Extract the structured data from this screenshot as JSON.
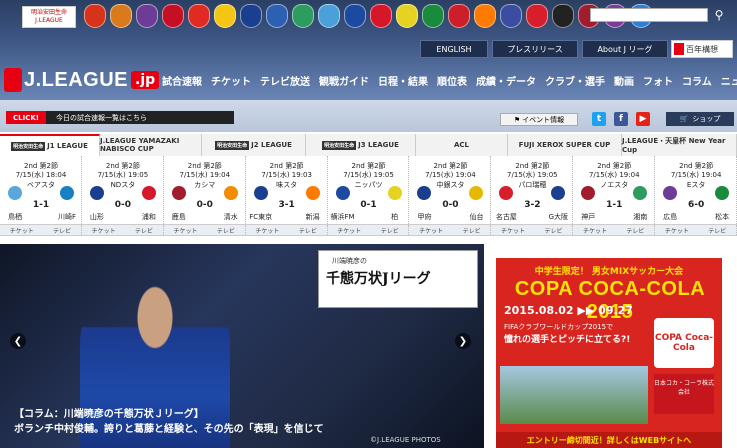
{
  "header": {
    "sponsor_top": "明治安田生命",
    "sponsor_bottom": "J.LEAGUE",
    "crest_colors": [
      "#d5341b",
      "#d97a1c",
      "#6d3c96",
      "#c60f25",
      "#e02a22",
      "#f2c613",
      "#1b3f8f",
      "#2d5fb3",
      "#2d9c5f",
      "#4aa0d8",
      "#1b4aa0",
      "#d6172a",
      "#e6d321",
      "#1a8a3c",
      "#cc1f2a",
      "#ff7a00",
      "#3b4da0",
      "#d81e2b",
      "#222",
      "#a11c2c",
      "#7b3c98",
      "#2e7fd0"
    ],
    "search_placeholder": "",
    "buttons": {
      "english": "ENGLISH",
      "press": "プレスリリース",
      "about": "About J リーグ"
    },
    "vision_label": "百年構想"
  },
  "logo": {
    "text": "J.LEAGUE",
    "suffix": ".jp"
  },
  "nav": [
    "試合速報",
    "チケット",
    "テレビ放送",
    "観戦ガイド",
    "日程・結果",
    "順位表",
    "成績・データ",
    "クラブ・選手",
    "動画",
    "フォト",
    "コラム",
    "ニュース"
  ],
  "subbar": {
    "click_label": "CLICK!",
    "today_label": "今日の試合速報一覧はこちら",
    "event_label": "イベント情報",
    "shop_label": "ショップ"
  },
  "tabs": [
    {
      "badge": "明治安田生命",
      "label": "J1 LEAGUE",
      "active": true
    },
    {
      "badge": "",
      "label": "J.LEAGUE YAMAZAKI NABISCO CUP",
      "active": false
    },
    {
      "badge": "明治安田生命",
      "label": "J2 LEAGUE",
      "active": false
    },
    {
      "badge": "明治安田生命",
      "label": "J3 LEAGUE",
      "active": false
    },
    {
      "badge": "",
      "label": "ACL",
      "active": false
    },
    {
      "badge": "",
      "label": "FUJI XEROX SUPER CUP",
      "active": false
    },
    {
      "badge": "",
      "label": "J.LEAGUE・天皇杯 New Year Cup",
      "active": false
    }
  ],
  "matches": [
    {
      "round": "2nd 第2節",
      "date": "7/15(水) 18:04",
      "venue": "ベアスタ",
      "home": "鳥栖",
      "score": "1-1",
      "away": "川崎F",
      "hc": "#5aa7dc",
      "ac": "#1b7fc3"
    },
    {
      "round": "2nd 第2節",
      "date": "7/15(水) 19:05",
      "venue": "NDスタ",
      "home": "山形",
      "score": "0-0",
      "away": "浦和",
      "hc": "#1b3f8f",
      "ac": "#d6172a"
    },
    {
      "round": "2nd 第2節",
      "date": "7/15(水) 19:04",
      "venue": "カシマ",
      "home": "鹿島",
      "score": "0-0",
      "away": "清水",
      "hc": "#a11c2c",
      "ac": "#f28c00"
    },
    {
      "round": "2nd 第2節",
      "date": "7/15(水) 19:03",
      "venue": "味スタ",
      "home": "FC東京",
      "score": "3-1",
      "away": "新潟",
      "hc": "#1b3f8f",
      "ac": "#ff7a00"
    },
    {
      "round": "2nd 第2節",
      "date": "7/15(水) 19:05",
      "venue": "ニッパツ",
      "home": "横浜FM",
      "score": "0-1",
      "away": "柏",
      "hc": "#1b4aa0",
      "ac": "#e6d321"
    },
    {
      "round": "2nd 第2節",
      "date": "7/15(水) 19:04",
      "venue": "中銀スタ",
      "home": "甲府",
      "score": "0-0",
      "away": "仙台",
      "hc": "#1b3f8f",
      "ac": "#e6b800"
    },
    {
      "round": "2nd 第2節",
      "date": "7/15(水) 19:05",
      "venue": "パロ瑞穂",
      "home": "名古屋",
      "score": "3-2",
      "away": "G大阪",
      "hc": "#d81e2b",
      "ac": "#1b3f8f"
    },
    {
      "round": "2nd 第2節",
      "date": "7/15(水) 19:04",
      "venue": "ノエスタ",
      "home": "神戸",
      "score": "1-1",
      "away": "湘南",
      "hc": "#a11c2c",
      "ac": "#2d9c5f"
    },
    {
      "round": "2nd 第2節",
      "date": "7/15(水) 19:04",
      "venue": "Eスタ",
      "home": "広島",
      "score": "6-0",
      "away": "松本",
      "hc": "#6d3c96",
      "ac": "#1a8a3c"
    }
  ],
  "foot_labels": {
    "ticket": "チケット",
    "tv": "テレビ"
  },
  "hero": {
    "badge_small": "川端暁彦の",
    "badge_title": "千態万状Jリーグ",
    "caption1": "【コラム：川端暁彦の千態万状Ｊリーグ】",
    "caption2": "ボランチ中村俊輔。誇りと葛藤と経験と、その先の「表現」を信じて",
    "credit": "©J.LEAGUE PHOTOS"
  },
  "ad": {
    "top": "中学生限定！ 男女MIXサッカー大会",
    "title": "COPA COCA-COLA 2015",
    "dates": "2015.08.02 ▶▶ 09.27",
    "sub1": "FIFAクラブワールドカップ2015で",
    "sub2": "憧れの選手とピッチに立てる?!",
    "copa": "COPA Coca-Cola",
    "badge": "日本コカ・コーラ株式会社",
    "bottom": "エントリー締切間近！詳しくはWEBサイトへ"
  }
}
